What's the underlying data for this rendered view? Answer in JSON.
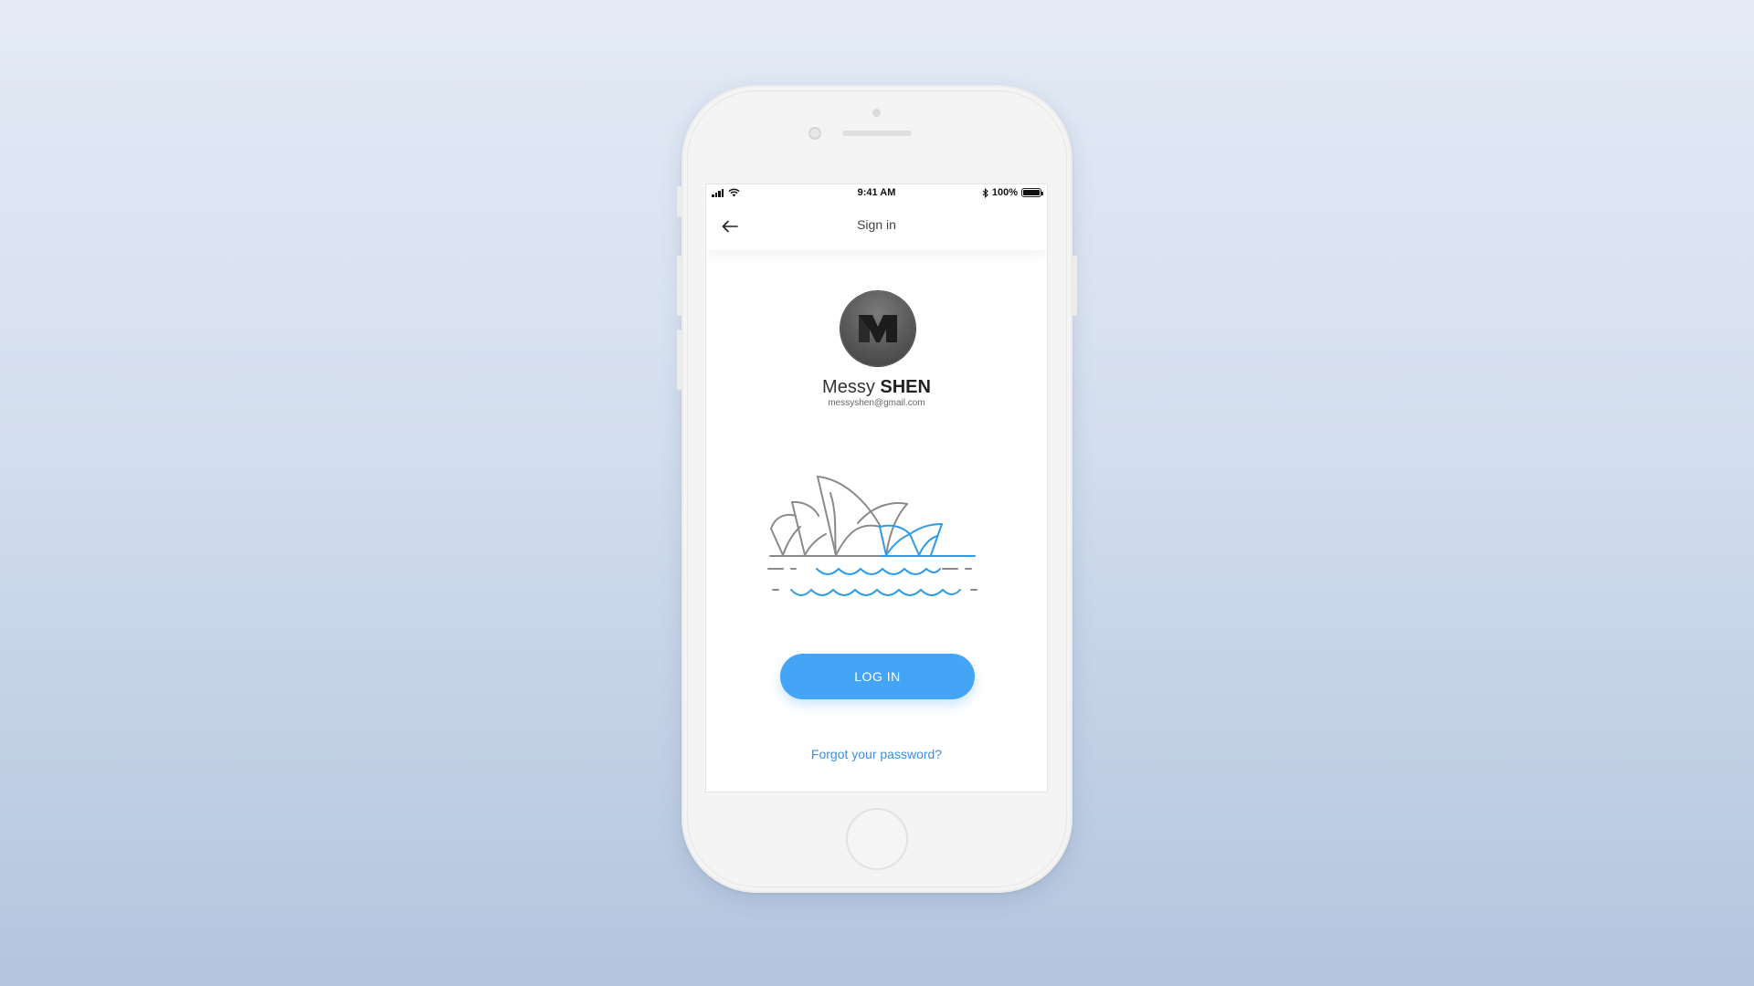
{
  "status_bar": {
    "time": "9:41 AM",
    "battery_percent": "100%",
    "icons": [
      "signal-icon",
      "wifi-icon",
      "bluetooth-icon",
      "battery-icon"
    ]
  },
  "nav": {
    "title": "Sign in",
    "back_icon": "arrow-left-icon"
  },
  "profile": {
    "first_name": "Messy",
    "last_name": "SHEN",
    "email": "messyshen@gmail.com",
    "avatar_icon": "m-logo-icon"
  },
  "illustration": {
    "name": "sydney-opera-house-illustration",
    "colors": {
      "outline": "#8a8a8a",
      "accent": "#2f9be8"
    }
  },
  "actions": {
    "login_label": "LOG IN",
    "forgot_label": "Forgot your password?"
  },
  "colors": {
    "primary": "#44a4f5",
    "link": "#3d8ee0",
    "background_top": "#e4ebf6",
    "background_bottom": "#b3c5de"
  }
}
